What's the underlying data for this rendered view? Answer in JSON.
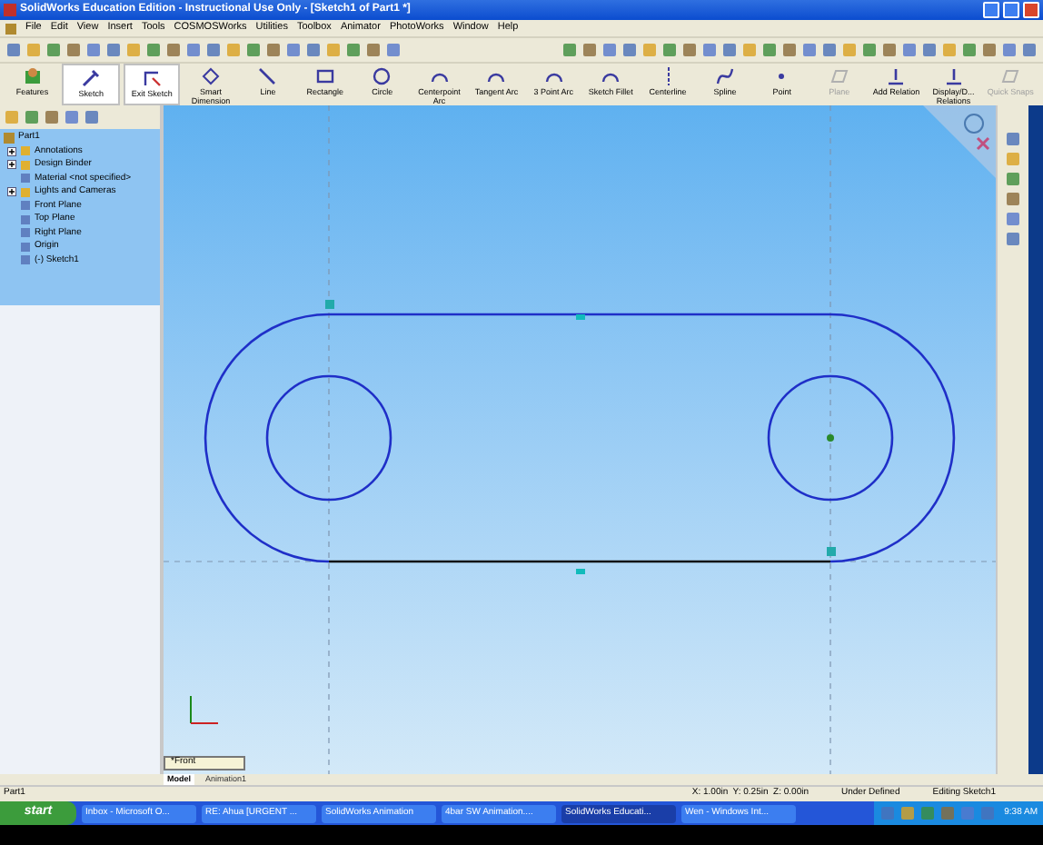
{
  "window": {
    "title": "SolidWorks Education Edition - Instructional Use Only - [Sketch1 of Part1 *]"
  },
  "menu": [
    "File",
    "Edit",
    "View",
    "Insert",
    "Tools",
    "COSMOSWorks",
    "Utilities",
    "Toolbox",
    "Animator",
    "PhotoWorks",
    "Window",
    "Help"
  ],
  "command_manager": [
    {
      "label": "Features",
      "kind": "features",
      "disabled": false,
      "selected": false
    },
    {
      "label": "Sketch",
      "kind": "sketch",
      "disabled": false,
      "selected": true
    },
    {
      "label": "Exit Sketch",
      "kind": "exit",
      "disabled": false,
      "selected": true
    },
    {
      "label": "Smart Dimension",
      "kind": "dimension",
      "disabled": false,
      "selected": false
    },
    {
      "label": "Line",
      "kind": "line",
      "disabled": false,
      "selected": false
    },
    {
      "label": "Rectangle",
      "kind": "rectangle",
      "disabled": false,
      "selected": false
    },
    {
      "label": "Circle",
      "kind": "circle",
      "disabled": false,
      "selected": false
    },
    {
      "label": "Centerpoint Arc",
      "kind": "arc",
      "disabled": false,
      "selected": false
    },
    {
      "label": "Tangent Arc",
      "kind": "arc",
      "disabled": false,
      "selected": false
    },
    {
      "label": "3 Point Arc",
      "kind": "arc",
      "disabled": false,
      "selected": false
    },
    {
      "label": "Sketch Fillet",
      "kind": "arc",
      "disabled": false,
      "selected": false
    },
    {
      "label": "Centerline",
      "kind": "centerline",
      "disabled": false,
      "selected": false
    },
    {
      "label": "Spline",
      "kind": "spline",
      "disabled": false,
      "selected": false
    },
    {
      "label": "Point",
      "kind": "point",
      "disabled": false,
      "selected": false
    },
    {
      "label": "Plane",
      "kind": "plane",
      "disabled": true,
      "selected": false
    },
    {
      "label": "Add Relation",
      "kind": "relation",
      "disabled": false,
      "selected": false
    },
    {
      "label": "Display/D... Relations",
      "kind": "relation",
      "disabled": false,
      "selected": false
    },
    {
      "label": "Quick Snaps",
      "kind": "plane",
      "disabled": true,
      "selected": false
    }
  ],
  "feature_tree": {
    "label": "Part1",
    "children": [
      {
        "label": "Annotations",
        "expanded": false
      },
      {
        "label": "Design Binder",
        "expanded": false
      },
      {
        "label": "Material <not specified>"
      },
      {
        "label": "Lights and Cameras",
        "expanded": false
      },
      {
        "label": "Front Plane"
      },
      {
        "label": "Top Plane"
      },
      {
        "label": "Right Plane"
      },
      {
        "label": "Origin"
      },
      {
        "label": "(-) Sketch1"
      }
    ]
  },
  "view_selector": "*Front",
  "tabs": [
    {
      "label": "Model",
      "selected": true
    },
    {
      "label": "Animation1",
      "selected": false
    }
  ],
  "status_bar": {
    "document": "Part1",
    "coordinates": "X: 1.00in  Y: 0.25in  Z: 0.00in",
    "state": "Under Defined",
    "mode": "Editing Sketch1"
  },
  "taskbar": {
    "start": "start",
    "tasks": [
      {
        "label": "Inbox - Microsoft O...",
        "selected": false
      },
      {
        "label": "RE: Ahua [URGENT ...",
        "selected": false
      },
      {
        "label": "SolidWorks Animation",
        "selected": false
      },
      {
        "label": "4bar SW Animation....",
        "selected": false
      },
      {
        "label": "SolidWorks Educati...",
        "selected": true
      },
      {
        "label": "Wen - Windows Int...",
        "selected": false
      }
    ],
    "clock": "9:38 AM"
  }
}
